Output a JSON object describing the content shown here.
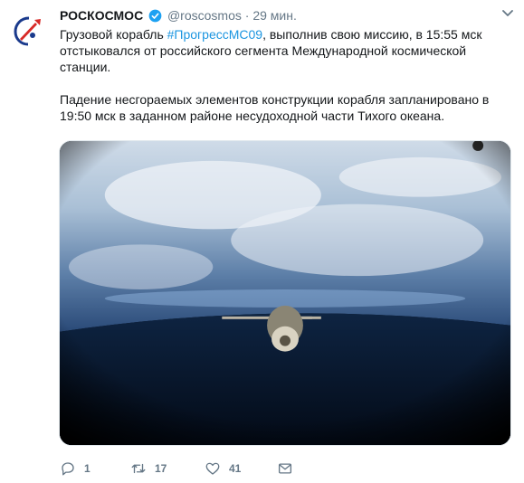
{
  "tweet": {
    "author_name": "РОСКОСМОС",
    "handle": "@roscosmos",
    "separator": "·",
    "time": "29 мин.",
    "text": {
      "line1_prefix": "Грузовой корабль ",
      "hashtag": "#ПрогрессМС09",
      "line1_suffix": ", выполнив свою миссию, в 15:55 мск отстыковался от российского сегмента Международной космической станции.",
      "paragraph2": "Падение несгораемых элементов конструкции корабля запланировано в 19:50 мск в заданном районе несудоходной части Тихого океана."
    },
    "actions": {
      "replies": "1",
      "retweets": "17",
      "likes": "41"
    }
  },
  "colors": {
    "link": "#1b95e0",
    "secondary_text": "#657786",
    "brand_red": "#d72927",
    "brand_blue": "#1a3a8c",
    "verified": "#1da1f2"
  },
  "icons": {
    "avatar": "roscosmos-logo",
    "verified": "verified-badge-icon",
    "caret": "chevron-down-icon",
    "reply": "reply-icon",
    "retweet": "retweet-icon",
    "like": "heart-icon",
    "dm": "envelope-icon"
  }
}
